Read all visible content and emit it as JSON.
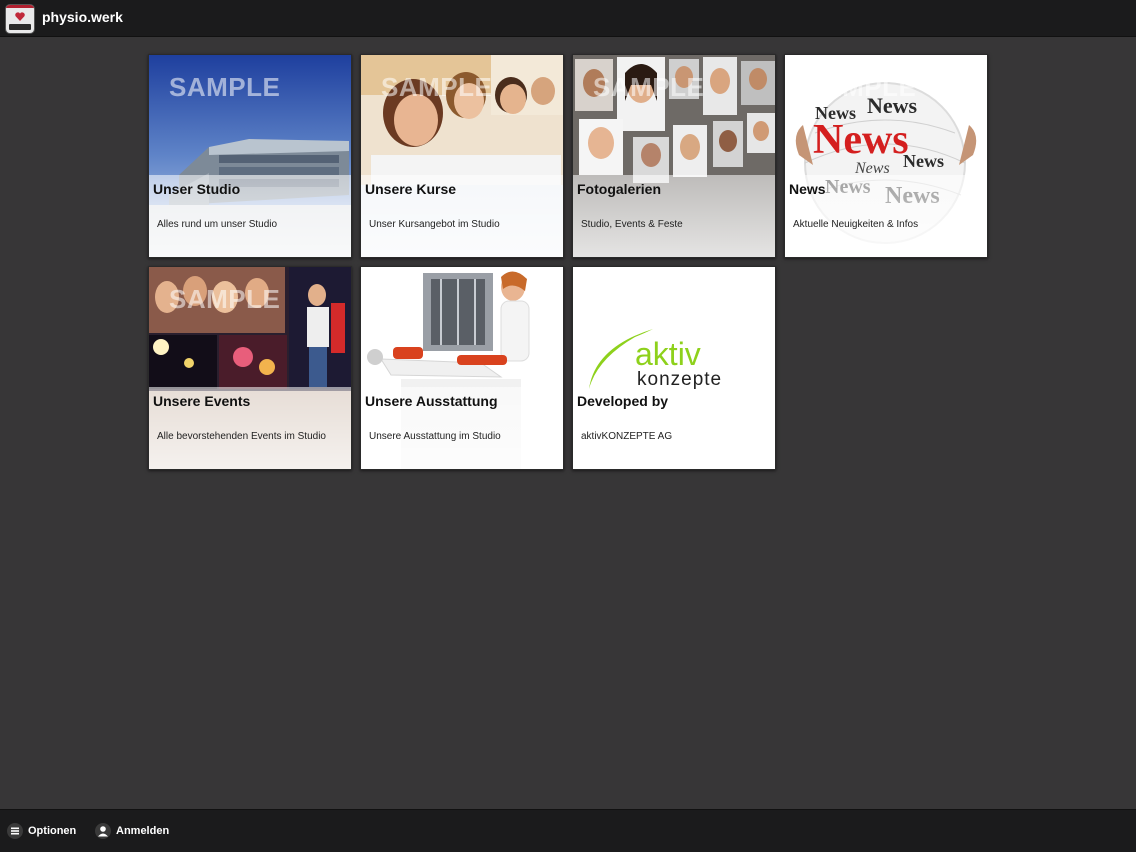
{
  "header": {
    "app_name": "physio.werk",
    "app_icon": "studio-logo-icon"
  },
  "tiles": [
    {
      "title": "Unser Studio",
      "subtitle": "Alles rund um unser Studio",
      "watermark": "SAMPLE"
    },
    {
      "title": "Unsere Kurse",
      "subtitle": "Unser Kursangebot im Studio",
      "watermark": "SAMPLE"
    },
    {
      "title": "Fotogalerien",
      "subtitle": "Studio, Events & Feste",
      "watermark": "SAMPLE"
    },
    {
      "title": "News",
      "subtitle": "Aktuelle Neuigkeiten & Infos",
      "watermark": "SAMPLE"
    },
    {
      "title": "Unsere Events",
      "subtitle": "Alle bevorstehenden Events im Studio",
      "watermark": "SAMPLE"
    },
    {
      "title": "Unsere Ausstattung",
      "subtitle": "Unsere Ausstattung im Studio"
    },
    {
      "title": "Developed by",
      "subtitle": "aktivKONZEPTE AG",
      "logo_word_1": "aktiv",
      "logo_word_2": "konzepte"
    }
  ],
  "footer": {
    "options_label": "Optionen",
    "options_icon": "menu-icon",
    "login_label": "Anmelden",
    "login_icon": "user-icon"
  },
  "colors": {
    "background": "#373637",
    "bars": "#1b1b1c",
    "accent_green": "#8ed11c",
    "news_red": "#d41f1f"
  }
}
